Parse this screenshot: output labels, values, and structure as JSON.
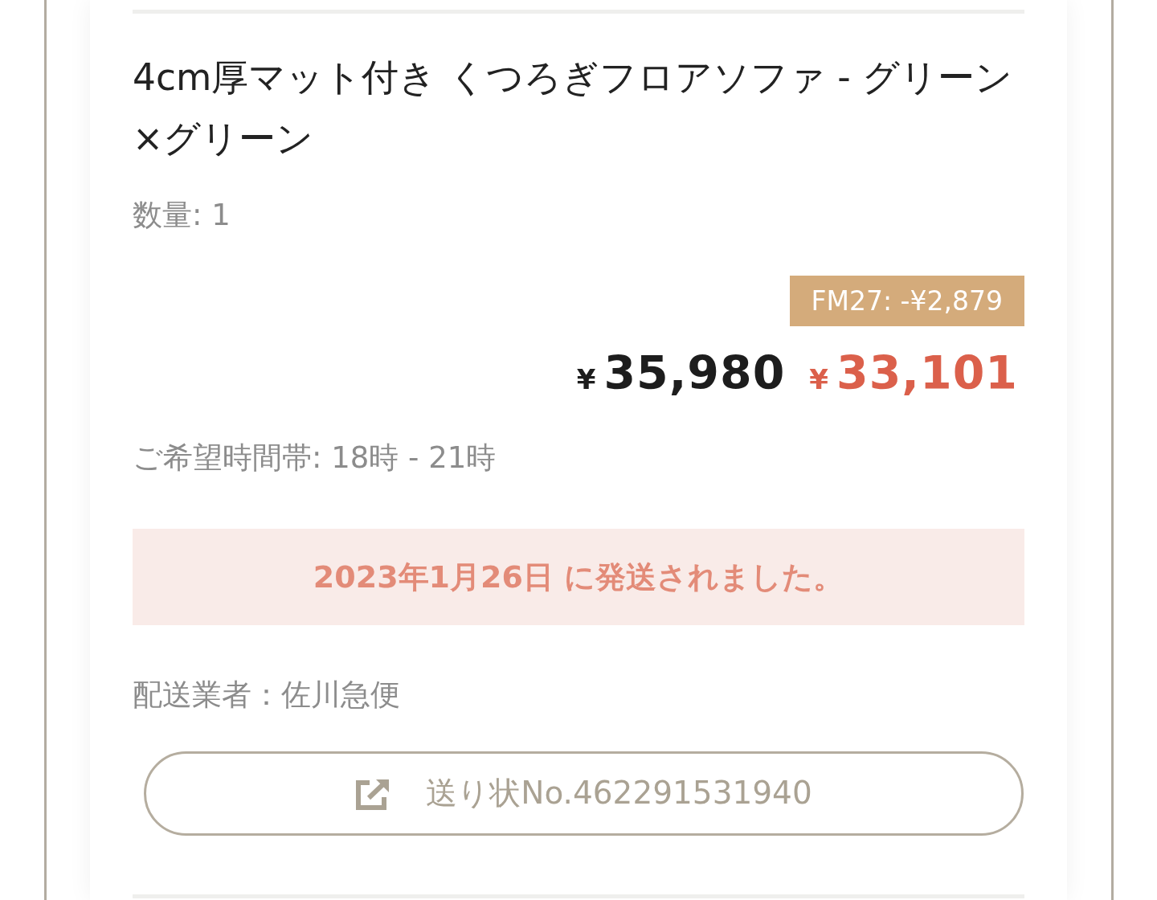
{
  "item": {
    "title": "4cm厚マット付き くつろぎフロアソファ - グリーン×グリーン",
    "quantity": "数量: 1",
    "discount_badge": "FM27: -¥2,879",
    "prices": [
      {
        "kind": "original",
        "currency": "¥",
        "amount": "35,980"
      },
      {
        "kind": "sale",
        "currency": "¥",
        "amount": "33,101"
      }
    ],
    "delivery_time": "ご希望時間帯: 18時 - 21時",
    "shipping_notice": "2023年1月26日 に発送されました。",
    "carrier": "配送業者：佐川急便",
    "tracking_button": "送り状No.462291531940"
  }
}
